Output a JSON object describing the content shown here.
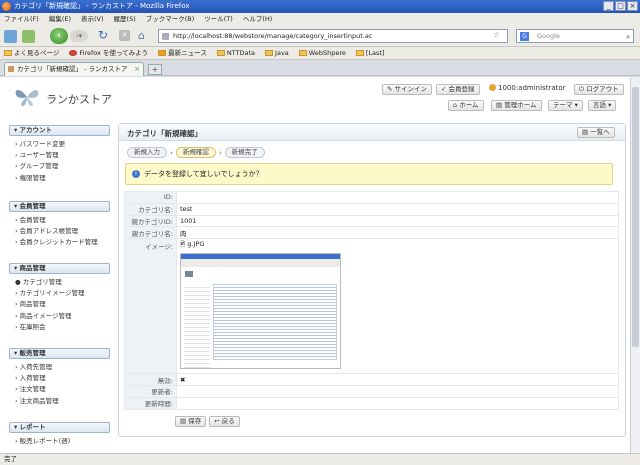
{
  "window": {
    "title": "カテゴリ「新規確認」 - ランカストア - Mozilla Firefox",
    "controls": [
      "_",
      "□",
      "×"
    ]
  },
  "menu": [
    "ファイル(F)",
    "編集(E)",
    "表示(V)",
    "履歴(S)",
    "ブックマーク(B)",
    "ツール(T)",
    "ヘルプ(H)"
  ],
  "nav": {
    "url": "http://localhost:88/webstore/manage/category_insertinput.ac",
    "search_placeholder": "Google"
  },
  "bookmarks": [
    "よく見るページ",
    "Firefox を使ってみよう",
    "最新ニュース",
    "NTTData",
    "Java",
    "WebShpere",
    "[Last]"
  ],
  "tab": {
    "label": "カテゴリ「新規確認」 - ランカストア"
  },
  "header": {
    "app_title": "ランかストア",
    "signin": "サインイン",
    "register": "会員登録",
    "user": "1000:administrator",
    "logout": "ログアウト",
    "home": "ホーム",
    "admin_home": "管理ホーム",
    "theme": "テーマ",
    "language": "言語"
  },
  "sidebar": [
    {
      "title": "アカウント",
      "items": [
        "パスワード変更",
        "ユーザー管理",
        "グループ管理",
        "権限管理"
      ]
    },
    {
      "title": "会員管理",
      "items": [
        "会員管理",
        "会員アドレス帳管理",
        "会員クレジットカード管理"
      ]
    },
    {
      "title": "商品管理",
      "items": [
        "カテゴリ管理",
        "カテゴリイメージ管理",
        "商品管理",
        "商品イメージ管理",
        "在庫照会"
      ]
    },
    {
      "title": "販売管理",
      "items": [
        "入荷先管理",
        "入荷管理",
        "注文管理",
        "注文商品管理"
      ]
    },
    {
      "title": "レポート",
      "items": [
        "販売レポート(週)"
      ]
    }
  ],
  "main": {
    "title": "カテゴリ「新規確認」",
    "list_button": "一覧へ",
    "steps": [
      "新規入力",
      "新規確認",
      "新規完了"
    ],
    "notice": "データを登録して宜しいでしょうか？",
    "fields": [
      {
        "label": "ID:",
        "value": ""
      },
      {
        "label": "カテゴリ名:",
        "value": "test"
      },
      {
        "label": "親カテゴリID:",
        "value": "1001"
      },
      {
        "label": "親カテゴリ名:",
        "value": "肉"
      },
      {
        "label": "イメージ:",
        "value": "g.JPG"
      },
      {
        "label": "無効:",
        "value": "✖"
      },
      {
        "label": "更新者:",
        "value": ""
      },
      {
        "label": "更新時間:",
        "value": ""
      }
    ],
    "save": "保存",
    "back": "戻る"
  },
  "status": "完了"
}
